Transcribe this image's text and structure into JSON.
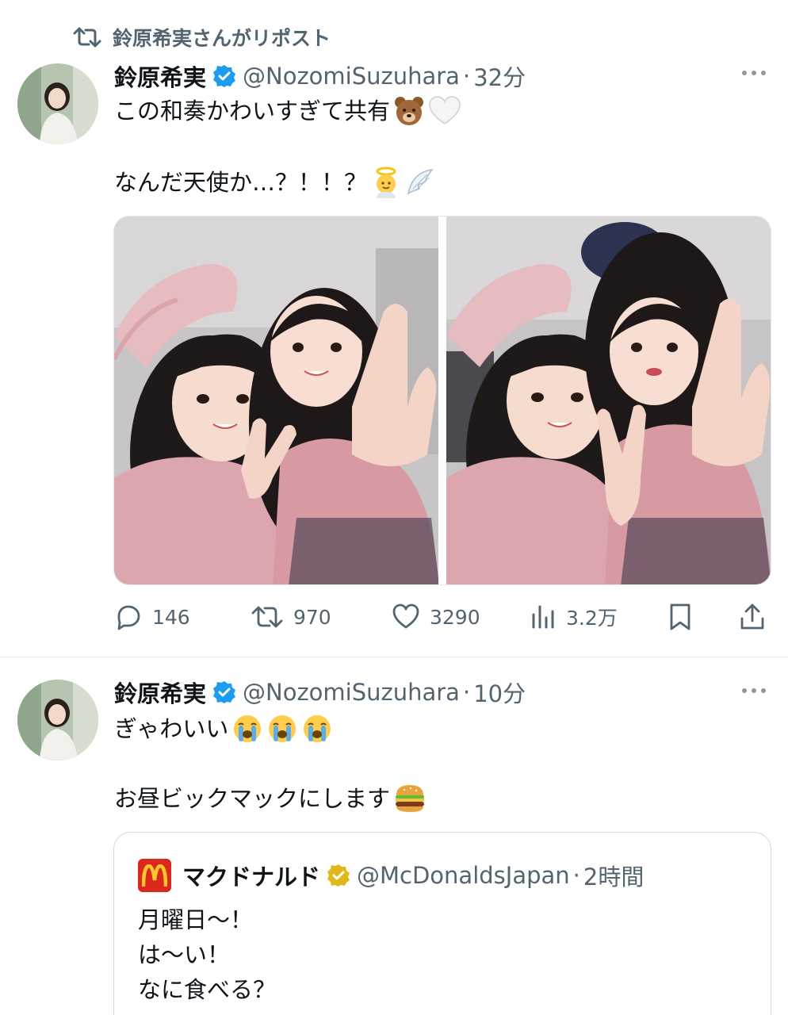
{
  "repost_banner": {
    "text": "鈴原希実さんがリポスト"
  },
  "tweets": [
    {
      "author": {
        "name": "鈴原希実",
        "handle": "@NozomiSuzuhara",
        "time": "32分"
      },
      "lines": [
        "この和奏かわいすぎて共有",
        "なんだ天使か…？！！？"
      ],
      "line_emojis": [
        [
          "bear-face-emoji",
          "white-heart-emoji"
        ],
        [
          "baby-angel-emoji",
          "wing-emoji"
        ]
      ],
      "stats": {
        "replies": "146",
        "reposts": "970",
        "likes": "3290",
        "views": "3.2万"
      }
    },
    {
      "author": {
        "name": "鈴原希実",
        "handle": "@NozomiSuzuhara",
        "time": "10分"
      },
      "lines": [
        "ぎゃわいい",
        "お昼ビックマックにします"
      ],
      "line_emojis": [
        [
          "crying-face-emoji",
          "crying-face-emoji",
          "crying-face-emoji"
        ],
        [
          "hamburger-emoji"
        ]
      ],
      "quote": {
        "name": "マクドナルド",
        "handle": "@McDonaldsJapan",
        "time": "2時間",
        "lines": [
          "月曜日〜！",
          "は〜い！",
          "なに食べる？"
        ]
      }
    }
  ],
  "colors": {
    "verified_blue": "#1d9bf0",
    "verified_gold": "#e2b719",
    "secondary_text": "#536471",
    "mcd_red": "#da291c",
    "mcd_yellow": "#ffc72c"
  },
  "separator": "·"
}
